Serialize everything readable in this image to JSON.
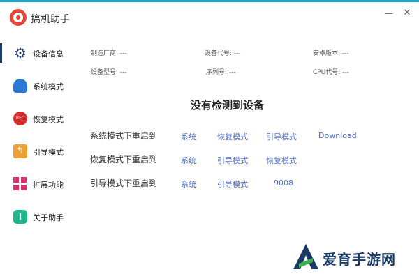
{
  "window": {
    "title": "搞机助手",
    "minimize_glyph": "—",
    "close_glyph": "✕",
    "accent_color": "#1aa6c8"
  },
  "sidebar": {
    "items": [
      {
        "label": "设备信息",
        "icon": "gear-icon",
        "active": true
      },
      {
        "label": "系统模式",
        "icon": "android-icon",
        "active": false
      },
      {
        "label": "恢复模式",
        "icon": "rec-icon",
        "icon_text": "REC",
        "active": false
      },
      {
        "label": "引导模式",
        "icon": "back-arrow-icon",
        "icon_text": "↰",
        "active": false
      },
      {
        "label": "扩展功能",
        "icon": "grid-icon",
        "active": false
      },
      {
        "label": "关于助手",
        "icon": "info-icon",
        "icon_text": "!",
        "active": false
      }
    ]
  },
  "device_info": {
    "manufacturer": "制造厂商: ---",
    "device_code": "设备代号: ---",
    "android_version": "安卓版本: ---",
    "device_model": "设备型号: ---",
    "serial": "序列号: ---",
    "cpu_code": "CPU代号: ---"
  },
  "status_heading": "没有检测到设备",
  "reboot_rows": [
    {
      "label": "系统模式下重启到",
      "links": [
        "系统",
        "恢复模式",
        "引导模式",
        "Download"
      ]
    },
    {
      "label": "恢复模式下重启到",
      "links": [
        "系统",
        "引导模式",
        "恢复模式"
      ]
    },
    {
      "label": "引导模式下重启到",
      "links": [
        "系统",
        "引导模式",
        "9008"
      ]
    }
  ],
  "watermark": {
    "text": "爱育手游网"
  },
  "colors": {
    "link": "#4f6fd0",
    "sidebar_active": "#1f3a6b"
  }
}
